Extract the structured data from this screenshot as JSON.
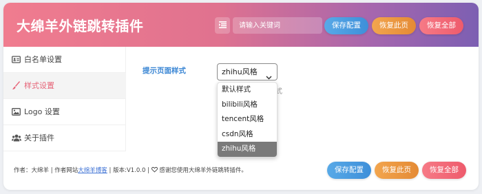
{
  "header": {
    "title": "大绵羊外链跳转插件",
    "search_placeholder": "请输入关键词",
    "save_label": "保存配置",
    "restore_label": "恢复此页",
    "restore_all_label": "恢复全部",
    "menu_icon": "list-icon"
  },
  "sidebar": {
    "items": [
      {
        "label": "白名单设置",
        "icon": "id-card-icon"
      },
      {
        "label": "样式设置",
        "icon": "brush-icon"
      },
      {
        "label": "Logo 设置",
        "icon": "image-icon"
      },
      {
        "label": "关于插件",
        "icon": "users-icon"
      }
    ],
    "active_index": 1
  },
  "main": {
    "field_label": "提示页面样式",
    "select_value": "zhihu风格",
    "hint_text": "式",
    "options": [
      "默认样式",
      "bilibili风格",
      "tencent风格",
      "csdn风格",
      "zhihu风格"
    ],
    "selected_option": "zhihu风格"
  },
  "footer": {
    "author": "作者：大绵羊",
    "site_prefix": " | 作者网站",
    "site_link": "大绵羊博客",
    "version": " | 版本:V1.0.0 | ",
    "thanks": " 感谢您使用大绵羊外链跳转插件。",
    "save_label": "保存配置",
    "restore_label": "恢复此页",
    "restore_all_label": "恢复全部"
  },
  "colors": {
    "header_gradient_start": "#f07c8f",
    "header_gradient_end": "#7c5fb2",
    "accent_pink": "#e66377",
    "label_blue": "#3a86d4",
    "save_blue": "#4a9be0",
    "restore_orange": "#eb9640",
    "restore_all_red": "#f26a79"
  }
}
